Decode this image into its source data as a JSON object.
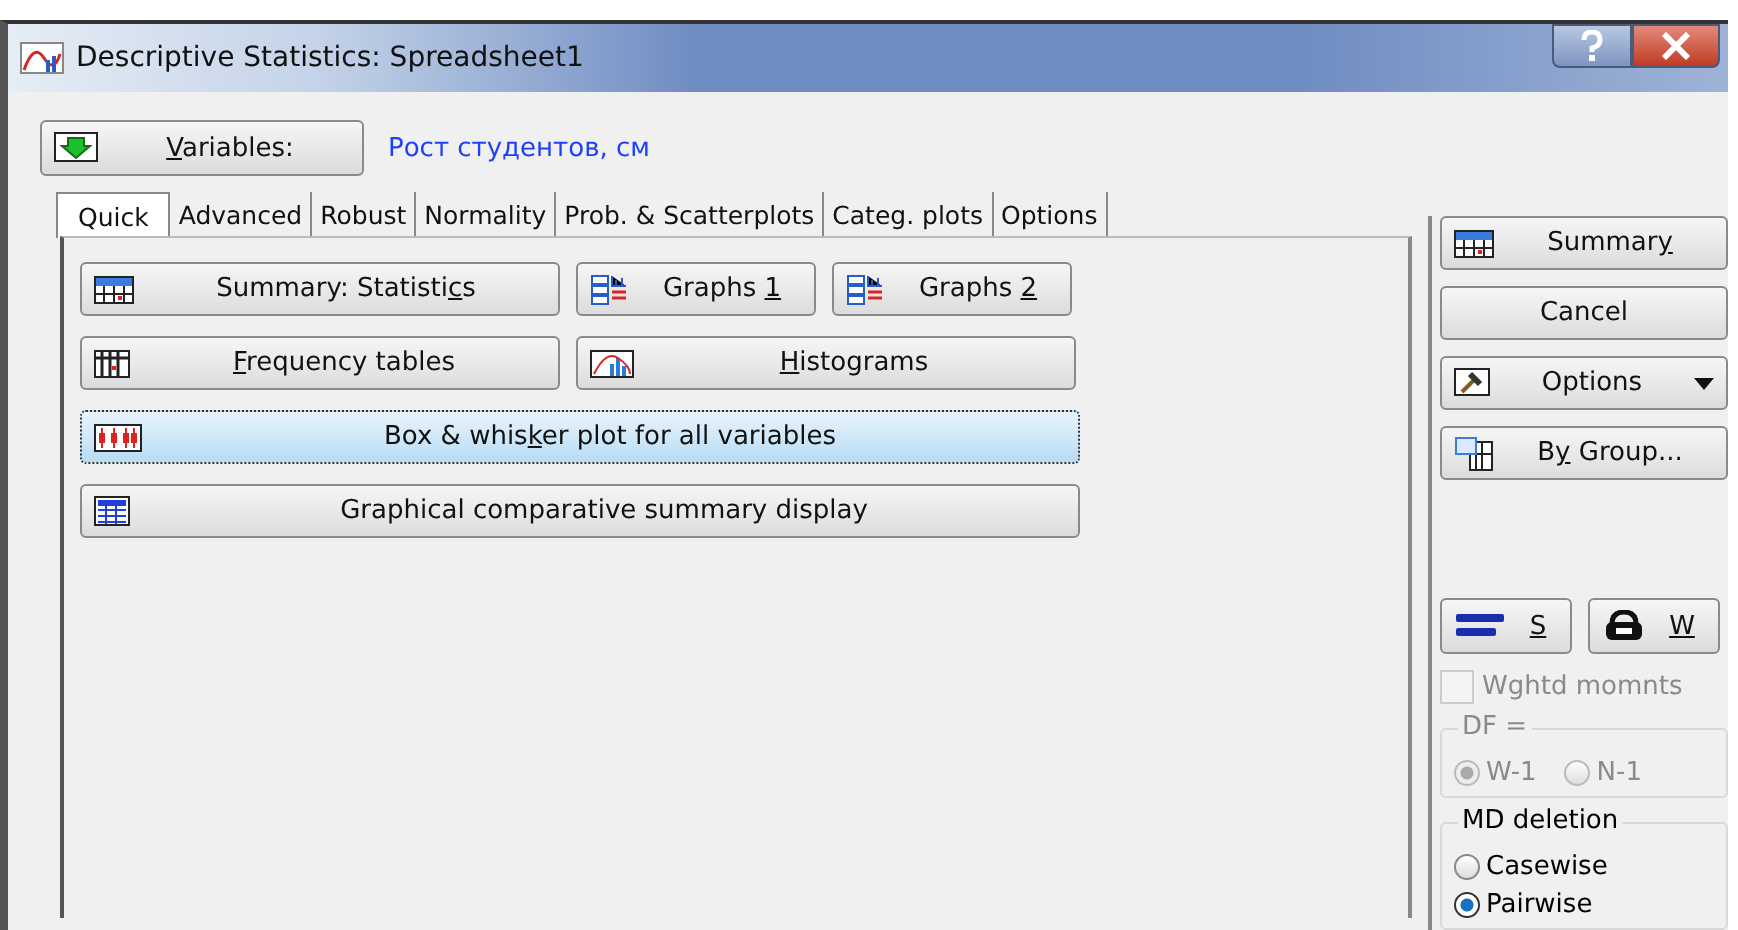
{
  "window": {
    "title": "Descriptive Statistics: Spreadsheet1"
  },
  "variables": {
    "button": {
      "key": "V",
      "after": "ariables:"
    },
    "value": "Рост студентов, см"
  },
  "tabs": [
    {
      "label": "Quick",
      "selected": true
    },
    {
      "label": "Advanced",
      "selected": false
    },
    {
      "label": "Robust",
      "selected": false
    },
    {
      "label": "Normality",
      "selected": false
    },
    {
      "label": "Prob. & Scatterplots",
      "selected": false
    },
    {
      "label": "Categ. plots",
      "selected": false
    },
    {
      "label": "Options",
      "selected": false
    }
  ],
  "quick_buttons": [
    [
      {
        "kind": "summary",
        "label": {
          "before": "Summary: Statisti",
          "key": "c",
          "after": "s"
        },
        "focused": false
      },
      {
        "kind": "graphs",
        "label": {
          "before": "Graphs ",
          "key": "1"
        },
        "focused": false
      },
      {
        "kind": "graphs",
        "label": {
          "before": "Graphs ",
          "key": "2"
        },
        "focused": false
      }
    ],
    [
      {
        "kind": "frequency",
        "label": {
          "key": "F",
          "after": "requency tables"
        },
        "focused": false
      },
      {
        "kind": "histogram",
        "label": {
          "key": "H",
          "after": "istograms"
        },
        "focused": false
      }
    ],
    [
      {
        "kind": "boxplot",
        "label": {
          "before": "Box & whis",
          "key": "k",
          "after": "er plot for all variables"
        },
        "focused": true
      }
    ],
    [
      {
        "kind": "table",
        "label": {
          "before": "Graphical comparative summary display"
        },
        "focused": false
      }
    ]
  ],
  "side_buttons": [
    {
      "kind": "summary",
      "label": {
        "before": "Summar",
        "key": "y"
      },
      "dropdown": false
    },
    {
      "kind": "plain",
      "label": {
        "before": "Cancel"
      },
      "dropdown": false
    },
    {
      "kind": "hammer",
      "label": {
        "before": "Options"
      },
      "dropdown": true
    },
    {
      "kind": "bygroup",
      "label": {
        "before": "B",
        "key": "y",
        "after": " Group..."
      },
      "dropdown": false
    }
  ],
  "case_buttons": [
    {
      "kind": "select",
      "label": {
        "key": "S"
      }
    },
    {
      "kind": "weight",
      "label": {
        "key": "W"
      }
    }
  ],
  "weighted_moments": {
    "label": "Wghtd momnts",
    "checked": false,
    "disabled": true
  },
  "df": {
    "title": "DF =",
    "disabled": true,
    "options": [
      {
        "label": "W-1",
        "selected": true
      },
      {
        "label": "N-1",
        "selected": false
      }
    ]
  },
  "md_deletion": {
    "title": "MD deletion",
    "disabled": false,
    "options": [
      {
        "label": "Casewise",
        "selected": false
      },
      {
        "label": "Pairwise",
        "selected": true
      }
    ]
  }
}
